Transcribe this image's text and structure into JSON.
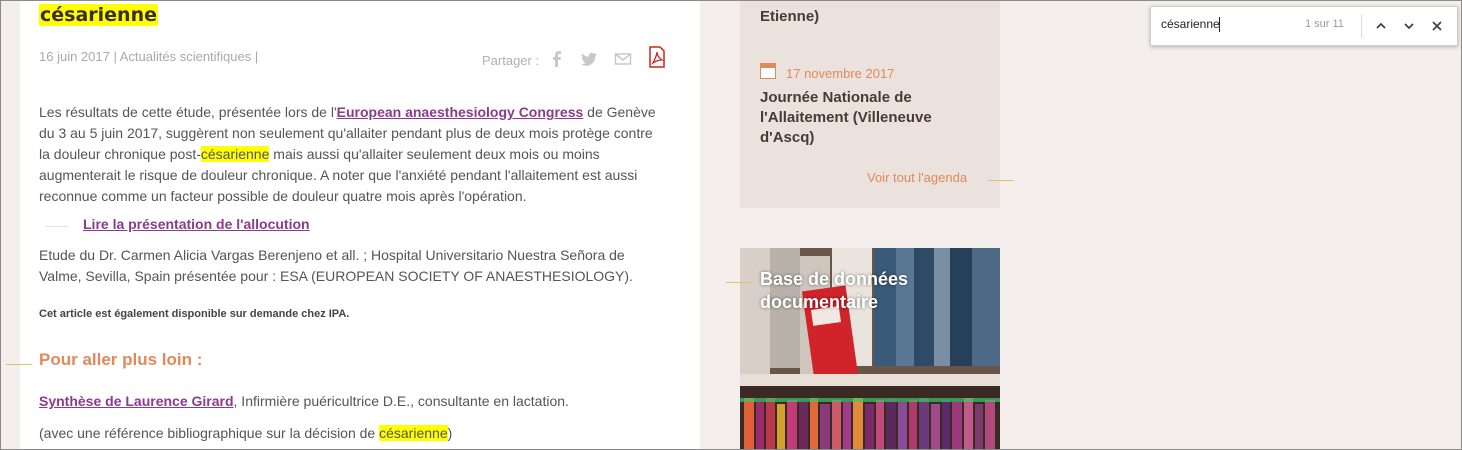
{
  "article": {
    "title": "césarienne",
    "meta": "16 juin 2017 | Actualités scientifiques |",
    "share_label": "Partager :",
    "share_icons": [
      "facebook-icon",
      "twitter-icon",
      "mail-icon",
      "pdf-icon"
    ],
    "paragraph": {
      "p1": "Les résultats de cette étude, présentée lors de l'",
      "link": "European anaesthesiology Congress",
      "p2": " de Genève du 3 au 5 juin 2017, suggèrent non seulement qu'allaiter pendant plus de deux mois protège contre la douleur chronique post-",
      "highlight": "césarienne",
      "p3": " mais aussi qu'allaiter seulement deux mois ou moins augmenterait le risque de douleur chronique. A noter que l'anxiété pendant l'allaitement est aussi reconnue comme un facteur possible de douleur quatre mois après l'opération."
    },
    "presentation_link": "Lire la présentation de l'allocution",
    "study": "Etude du Dr. Carmen Alicia Vargas Berenjeno et all. ; Hospital Universitario Nuestra Señora de Valme, Sevilla, Spain  présentée pour : ESA (EUROPEAN SOCIETY OF ANAESTHESIOLOGY).",
    "availability": "Cet article est également disponible sur demande chez IPA.",
    "further_heading": "Pour aller plus loin :",
    "synthesis_link": "Synthèse de Laurence Girard",
    "synthesis_rest": ",  Infirmière puéricultrice D.E., consultante en lactation.",
    "reference_pre": "(avec une référence bibliographique sur la décision de ",
    "reference_highlight": "césarienne",
    "reference_post": ")"
  },
  "sidebar": {
    "agenda_prev_tail": "Etienne)",
    "event_date": "17 novembre 2017",
    "event_title": "Journée Nationale de l'Allaitement (Villeneuve d'Ascq)",
    "see_all": "Voir tout l'agenda",
    "db_title": "Base de données documentaire"
  },
  "find_bar": {
    "query": "césarienne",
    "count": "1 sur 11",
    "prev_icon": "chevron-up-icon",
    "next_icon": "chevron-down-icon",
    "close_icon": "close-icon"
  },
  "colors": {
    "accent_orange": "#e08a5a",
    "link_purple": "#8c3a8c",
    "highlight": "#ffff00"
  }
}
